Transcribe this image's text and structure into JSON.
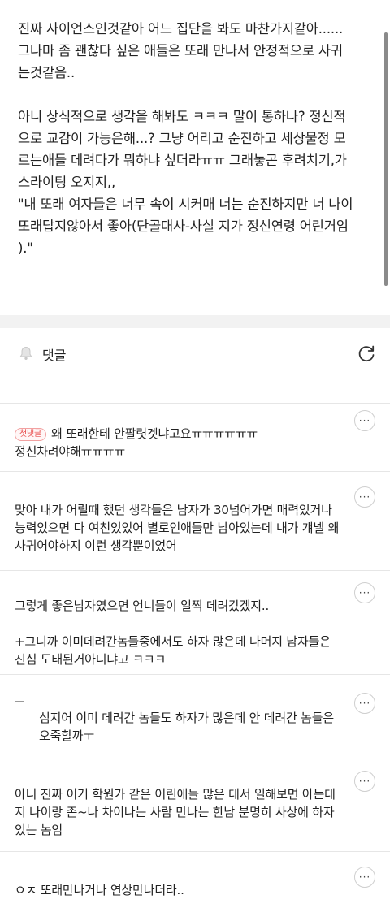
{
  "article": {
    "para1": [
      "진짜 사이언스인것같아 어느 집단을 봐도 마찬가지같아......",
      "그나마 좀 괜찮다 싶은 애들은 또래 만나서 안정적으로 사귀",
      "는것같음.."
    ],
    "para2": [
      "아니 상식적으로 생각을 해봐도 ㅋㅋㅋ 말이 통하나? 정신적",
      "으로 교감이 가능은해...? 그냥 어리고 순진하고 세상물정 모",
      "르는애들 데려다가 뭐하냐 싶더라ㅠㅠ 그래놓곤 후려치기,가",
      "스라이팅 오지지,,",
      "\"내 또래 여자들은 너무 속이 시커매 너는 순진하지만 너 나이",
      "또래답지않아서 좋아(단골대사-사실 지가 정신연령 어린거임",
      ").\""
    ]
  },
  "comments_section": {
    "title": "댓글",
    "icons": {
      "bell": "bell-icon",
      "refresh": "refresh-icon",
      "more": "more-options-icon"
    }
  },
  "comments": [
    {
      "badge": "첫댓글",
      "lines": [
        "왜 또래한테 안팔렷겟냐고요ㅠㅠㅠㅠㅠㅠ",
        "정신차려야해ㅠㅠㅠㅠ"
      ]
    },
    {
      "lines": [
        "맞아 내가 어릴때 했던 생각들은 남자가 30넘어가면 매력있거나",
        "능력있으면 다 여친있었어 별로인애들만 남아있는데 내가 걔넬 왜",
        "사귀어야하지 이런 생각뿐이었어"
      ]
    },
    {
      "lines": [
        "그렇게 좋은남자였으면 언니들이 일찍 데려갔겠지..",
        "",
        "+그니까 이미데려간놈들중에서도 하자 많은데 나머지 남자들은",
        "진심 도태된거아니냐고 ㅋㅋㅋ"
      ]
    },
    {
      "reply": true,
      "lines": [
        "심지어 이미 데려간 놈들도 하자가 많은데 안 데려간 놈들은",
        "오죽할까ㅜ"
      ]
    },
    {
      "lines": [
        "아니 진짜 이거 학원가 같은 어린애들 많은 데서 일해보면 아는데",
        "지 나이랑 존~나 차이나는 사람 만나는 한남 분명히 사상에 하자",
        "있는 놈임"
      ]
    },
    {
      "lines": [
        "ㅇㅈ 또래만나거나 연상만나더라.."
      ]
    }
  ],
  "more_label": "···"
}
